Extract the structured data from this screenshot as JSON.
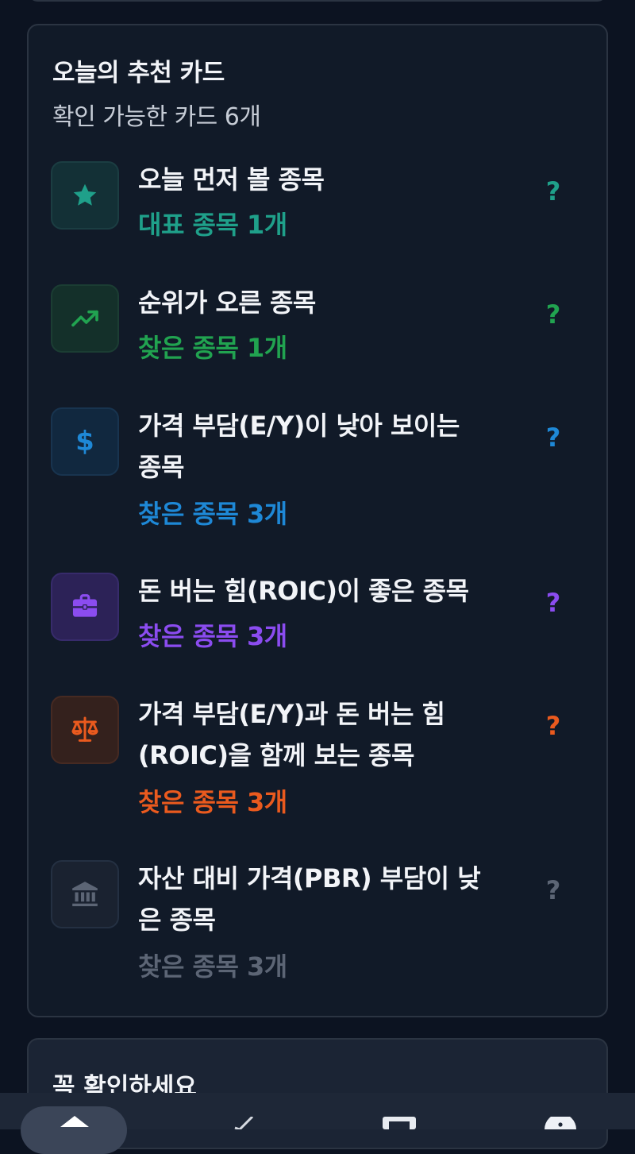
{
  "card": {
    "title": "오늘의 추천 카드",
    "subtitle": "확인 가능한 카드 6개"
  },
  "items": [
    {
      "title": "오늘 먼저 볼 종목",
      "count": "대표 종목 1개",
      "help": "?",
      "icon": "star-icon",
      "color": "#1fa08a"
    },
    {
      "title": "순위가 오른 종목",
      "count": "찾은 종목 1개",
      "help": "?",
      "icon": "trending-up-icon",
      "color": "#21a350"
    },
    {
      "title": "가격 부담(E/Y)이 낮아 보이는 종목",
      "count": "찾은 종목 3개",
      "help": "?",
      "icon": "dollar-icon",
      "color": "#1e88d6"
    },
    {
      "title": "돈 버는 힘(ROIC)이 좋은 종목",
      "count": "찾은 종목 3개",
      "help": "?",
      "icon": "briefcase-icon",
      "color": "#8b4cf0"
    },
    {
      "title": "가격 부담(E/Y)과 돈 버는 힘(ROIC)을 함께 보는 종목",
      "count": "찾은 종목 3개",
      "help": "?",
      "icon": "scale-icon",
      "color": "#ea5a1e"
    },
    {
      "title": "자산 대비 가격(PBR) 부담이 낮은 종목",
      "count": "찾은 종목 3개",
      "help": "?",
      "icon": "bank-icon",
      "color": "#5c6575"
    }
  ],
  "bottom": {
    "title": "꼭 확인하세요"
  }
}
